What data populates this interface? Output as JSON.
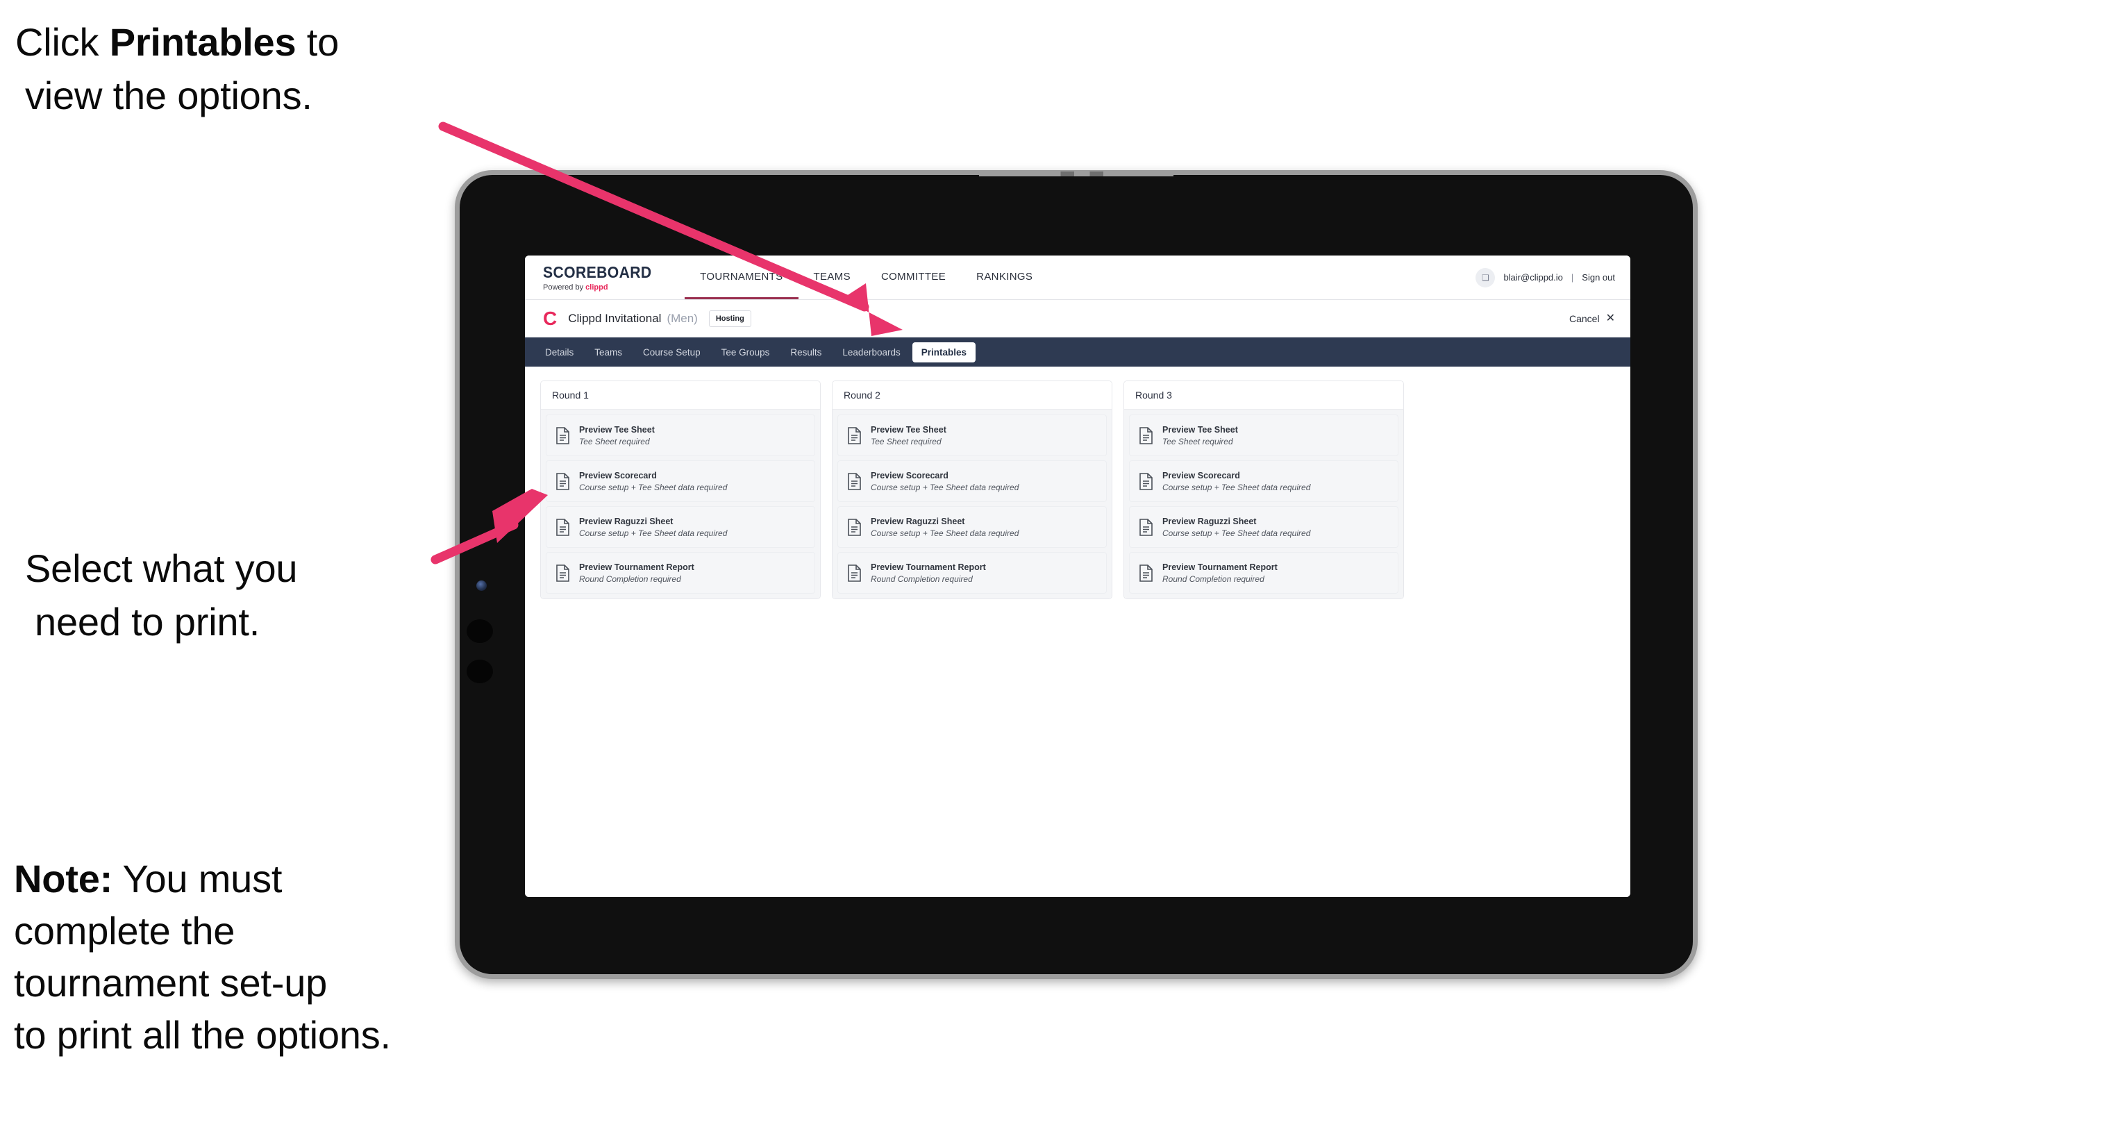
{
  "annotations": {
    "first": {
      "pre": "Click ",
      "bold": "Printables",
      "post": " to",
      "line2": "view the options."
    },
    "second": {
      "line1": "Select what you",
      "line2": "need to print."
    },
    "third": {
      "bold": "Note:",
      "rest": " You must",
      "line2": "complete the",
      "line3": "tournament set-up",
      "line4": "to print all the options."
    }
  },
  "app": {
    "brand": {
      "title": "SCOREBOARD",
      "sub_pre": "Powered by ",
      "sub_brand": "clippd"
    },
    "topnav": {
      "items": [
        {
          "label": "TOURNAMENTS",
          "active": true
        },
        {
          "label": "TEAMS",
          "active": false
        },
        {
          "label": "COMMITTEE",
          "active": false
        },
        {
          "label": "RANKINGS",
          "active": false
        }
      ],
      "avatar_glyph": "❑",
      "user_email": "blair@clippd.io",
      "separator": "|",
      "sign_out": "Sign out"
    },
    "tournament_bar": {
      "logo_letter": "C",
      "name": "Clippd Invitational",
      "gender": "(Men)",
      "status": "Hosting",
      "cancel_label": "Cancel",
      "cancel_icon": "✕"
    },
    "subnav": {
      "tabs": [
        {
          "label": "Details",
          "active": false
        },
        {
          "label": "Teams",
          "active": false
        },
        {
          "label": "Course Setup",
          "active": false
        },
        {
          "label": "Tee Groups",
          "active": false
        },
        {
          "label": "Results",
          "active": false
        },
        {
          "label": "Leaderboards",
          "active": false
        },
        {
          "label": "Printables",
          "active": true
        }
      ]
    },
    "rounds": [
      {
        "title": "Round 1",
        "items": [
          {
            "title": "Preview Tee Sheet",
            "sub": "Tee Sheet required"
          },
          {
            "title": "Preview Scorecard",
            "sub": "Course setup + Tee Sheet data required"
          },
          {
            "title": "Preview Raguzzi Sheet",
            "sub": "Course setup + Tee Sheet data required"
          },
          {
            "title": "Preview Tournament Report",
            "sub": "Round Completion required"
          }
        ]
      },
      {
        "title": "Round 2",
        "items": [
          {
            "title": "Preview Tee Sheet",
            "sub": "Tee Sheet required"
          },
          {
            "title": "Preview Scorecard",
            "sub": "Course setup + Tee Sheet data required"
          },
          {
            "title": "Preview Raguzzi Sheet",
            "sub": "Course setup + Tee Sheet data required"
          },
          {
            "title": "Preview Tournament Report",
            "sub": "Round Completion required"
          }
        ]
      },
      {
        "title": "Round 3",
        "items": [
          {
            "title": "Preview Tee Sheet",
            "sub": "Tee Sheet required"
          },
          {
            "title": "Preview Scorecard",
            "sub": "Course setup + Tee Sheet data required"
          },
          {
            "title": "Preview Raguzzi Sheet",
            "sub": "Course setup + Tee Sheet data required"
          },
          {
            "title": "Preview Tournament Report",
            "sub": "Round Completion required"
          }
        ]
      }
    ]
  },
  "colors": {
    "accent_pink": "#e8295c",
    "arrow_pink": "#e8346b",
    "subnav_bg": "#2e3a52",
    "brand_navy": "#232f45",
    "active_underline": "#9b3050"
  }
}
